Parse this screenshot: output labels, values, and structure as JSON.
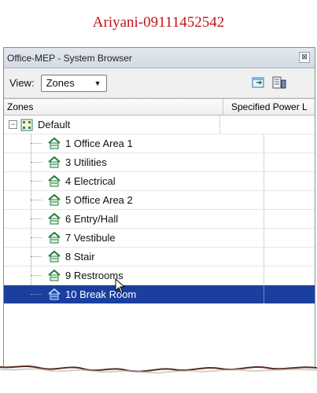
{
  "watermark": "Ariyani-09111452542",
  "window": {
    "title": "Office-MEP - System Browser",
    "close_glyph": "⊠"
  },
  "toolbar": {
    "view_label": "View:",
    "view_value": "Zones",
    "icons": [
      "column-settings-icon",
      "properties-icon"
    ]
  },
  "columns": {
    "zones": "Zones",
    "power": "Specified Power L"
  },
  "tree": {
    "root_label": "Default",
    "root_expander": "−",
    "items": [
      {
        "label": "1 Office Area 1"
      },
      {
        "label": "3 Utilities"
      },
      {
        "label": "4 Electrical"
      },
      {
        "label": "5 Office Area 2"
      },
      {
        "label": "6 Entry/Hall"
      },
      {
        "label": "7 Vestibule"
      },
      {
        "label": "8 Stair"
      },
      {
        "label": "9 Restrooms"
      },
      {
        "label": "10 Break Room",
        "selected": true
      }
    ]
  },
  "colors": {
    "watermark": "#c0141b",
    "selection": "#1b3f9e",
    "zone_icon": "#1f7a3a"
  }
}
